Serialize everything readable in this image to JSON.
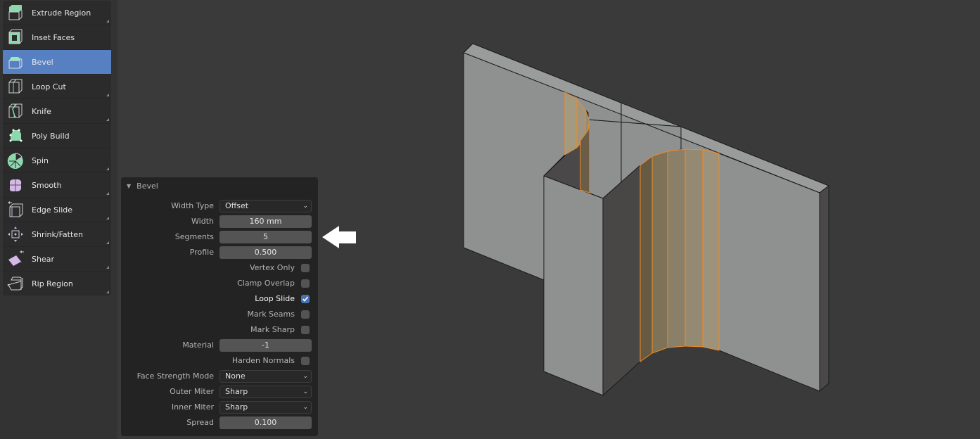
{
  "toolbar": {
    "items": [
      {
        "label": "Extrude Region",
        "icon": "extrude-region-icon",
        "active": false,
        "has_submenu": true
      },
      {
        "label": "Inset Faces",
        "icon": "inset-faces-icon",
        "active": false,
        "has_submenu": false
      },
      {
        "label": "Bevel",
        "icon": "bevel-icon",
        "active": true,
        "has_submenu": false
      },
      {
        "label": "Loop Cut",
        "icon": "loop-cut-icon",
        "active": false,
        "has_submenu": true
      },
      {
        "label": "Knife",
        "icon": "knife-icon",
        "active": false,
        "has_submenu": true
      },
      {
        "label": "Poly Build",
        "icon": "poly-build-icon",
        "active": false,
        "has_submenu": false
      },
      {
        "label": "Spin",
        "icon": "spin-icon",
        "active": false,
        "has_submenu": true
      },
      {
        "label": "Smooth",
        "icon": "smooth-icon",
        "active": false,
        "has_submenu": true
      },
      {
        "label": "Edge Slide",
        "icon": "edge-slide-icon",
        "active": false,
        "has_submenu": true
      },
      {
        "label": "Shrink/Fatten",
        "icon": "shrink-fatten-icon",
        "active": false,
        "has_submenu": true
      },
      {
        "label": "Shear",
        "icon": "shear-icon",
        "active": false,
        "has_submenu": true
      },
      {
        "label": "Rip Region",
        "icon": "rip-region-icon",
        "active": false,
        "has_submenu": true
      }
    ]
  },
  "bevel_panel": {
    "title": "Bevel",
    "collapse_icon": "triangle-down-icon",
    "width_type": {
      "label": "Width Type",
      "value": "Offset"
    },
    "width": {
      "label": "Width",
      "value": "160 mm"
    },
    "segments": {
      "label": "Segments",
      "value": "5"
    },
    "profile": {
      "label": "Profile",
      "value": "0.500"
    },
    "vertex_only": {
      "label": "Vertex Only",
      "checked": false
    },
    "clamp_overlap": {
      "label": "Clamp Overlap",
      "checked": false
    },
    "loop_slide": {
      "label": "Loop Slide",
      "checked": true
    },
    "mark_seams": {
      "label": "Mark Seams",
      "checked": false
    },
    "mark_sharp": {
      "label": "Mark Sharp",
      "checked": false
    },
    "material": {
      "label": "Material",
      "value": "-1"
    },
    "harden_normals": {
      "label": "Harden Normals",
      "checked": false
    },
    "face_strength_mode": {
      "label": "Face Strength Mode",
      "value": "None"
    },
    "outer_miter": {
      "label": "Outer Miter",
      "value": "Sharp"
    },
    "inner_miter": {
      "label": "Inner Miter",
      "value": "Sharp"
    },
    "spread": {
      "label": "Spread",
      "value": "0.100"
    }
  },
  "annotation": {
    "icon": "arrow-left-icon",
    "color": "#ffffff"
  },
  "viewport": {
    "object_color": "#8f9090",
    "shadow_color": "#4a4848",
    "selection_color": "#f08a24",
    "background": "#3a3a3a"
  },
  "colors": {
    "accent": "#5680c2",
    "checkbox_checked": "#4772b3",
    "icon_green": "#8ed8ad",
    "icon_purple": "#d4b8e6"
  }
}
